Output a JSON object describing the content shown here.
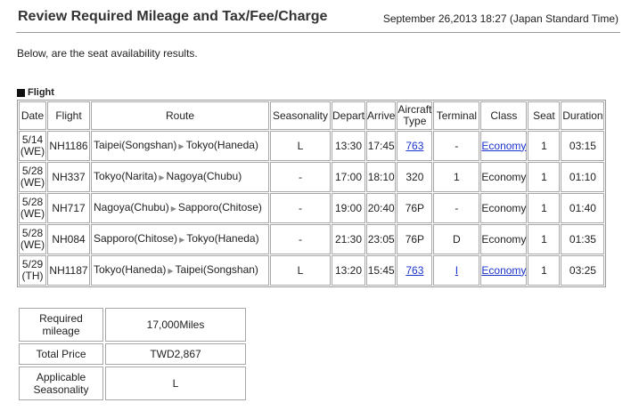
{
  "header": {
    "title": "Review Required Mileage and Tax/Fee/Charge",
    "datetime": "September 26,2013 18:27 (Japan Standard Time)"
  },
  "intro_text": "Below, are the seat availability results.",
  "flight_section": {
    "label": "Flight",
    "columns": {
      "date": "Date",
      "flight": "Flight",
      "route": "Route",
      "seasonality": "Seasonality",
      "depart": "Depart",
      "arrive": "Arrive",
      "aircraft_line1": "Aircraft",
      "aircraft_line2": "Type",
      "terminal": "Terminal",
      "class": "Class",
      "seat": "Seat",
      "duration": "Duration"
    },
    "rows": [
      {
        "date": "5/14",
        "dow": "(WE)",
        "flight": "NH1186",
        "from": "Taipei(Songshan)",
        "to": "Tokyo(Haneda)",
        "seasonality": "L",
        "depart": "13:30",
        "arrive": "17:45",
        "aircraft": "763",
        "terminal": "-",
        "class": "Economy",
        "seat": "1",
        "duration": "03:15"
      },
      {
        "date": "5/28",
        "dow": "(WE)",
        "flight": "NH337",
        "from": "Tokyo(Narita)",
        "to": "Nagoya(Chubu)",
        "seasonality": "-",
        "depart": "17:00",
        "arrive": "18:10",
        "aircraft": "320",
        "terminal": "1",
        "class": "Economy",
        "seat": "1",
        "duration": "01:10"
      },
      {
        "date": "5/28",
        "dow": "(WE)",
        "flight": "NH717",
        "from": "Nagoya(Chubu)",
        "to": "Sapporo(Chitose)",
        "seasonality": "-",
        "depart": "19:00",
        "arrive": "20:40",
        "aircraft": "76P",
        "terminal": "-",
        "class": "Economy",
        "seat": "1",
        "duration": "01:40"
      },
      {
        "date": "5/28",
        "dow": "(WE)",
        "flight": "NH084",
        "from": "Sapporo(Chitose)",
        "to": "Tokyo(Haneda)",
        "seasonality": "-",
        "depart": "21:30",
        "arrive": "23:05",
        "aircraft": "76P",
        "terminal": "D",
        "class": "Economy",
        "seat": "1",
        "duration": "01:35"
      },
      {
        "date": "5/29",
        "dow": "(TH)",
        "flight": "NH1187",
        "from": "Tokyo(Haneda)",
        "to": "Taipei(Songshan)",
        "seasonality": "L",
        "depart": "13:20",
        "arrive": "15:45",
        "aircraft": "763",
        "terminal": "I",
        "class": "Economy",
        "seat": "1",
        "duration": "03:25"
      }
    ]
  },
  "summary": {
    "required_mileage": {
      "label_line1": "Required",
      "label_line2": "mileage",
      "value": "17,000Miles"
    },
    "total_price": {
      "label": "Total Price",
      "value": "TWD2,867"
    },
    "applicable_seasonality": {
      "label_line1": "Applicable",
      "label_line2": "Seasonality",
      "value": "L"
    }
  },
  "icons": {
    "route_arrow": "right-triangle-arrow",
    "section_marker": "black-square"
  },
  "colors": {
    "link": "#1a33cc",
    "border": "#a8a8a8"
  }
}
